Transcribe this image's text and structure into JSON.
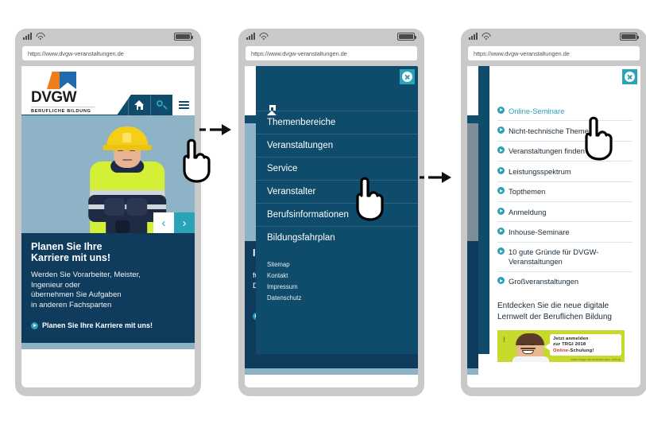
{
  "browser": {
    "url": "https://www.dvgw-veranstaltungen.de",
    "status_icons": {
      "signal": "signal-bars-icon",
      "wifi": "wifi-icon",
      "battery": "battery-icon"
    }
  },
  "brand": {
    "name": "DVGW",
    "tagline": "BERUFLICHE BILDUNG",
    "accent_blue": "#0f4c6b",
    "accent_teal": "#29a3b8",
    "accent_orange": "#ef7d1a",
    "deep_blue": "#0f3b5c"
  },
  "phone1": {
    "nav": {
      "home_icon": "home-icon",
      "search_icon": "search-icon",
      "menu_icon": "hamburger-menu-icon"
    },
    "hero": {
      "prev_label": "‹",
      "next_label": "›"
    },
    "teaser": {
      "heading_line1": "Planen Sie Ihre",
      "heading_line2": "Karriere mit uns!",
      "body_line1": "Werden Sie Vorarbeiter, Meister,",
      "body_line2": "Ingenieur oder",
      "body_line3": "übernehmen Sie Aufgaben",
      "body_line4": "in anderen Fachsparten",
      "link": "Planen Sie Ihre Karriere mit uns!"
    }
  },
  "phone2": {
    "close_icon": "close-icon",
    "home_icon": "home-icon",
    "menu_items": [
      {
        "label": "Themenbereiche"
      },
      {
        "label": "Veranstaltungen"
      },
      {
        "label": "Service"
      },
      {
        "label": "Veranstalter"
      },
      {
        "label": "Berufsinformationen"
      },
      {
        "label": "Bildungsfahrplan"
      }
    ],
    "footer_links": [
      {
        "label": "Sitemap"
      },
      {
        "label": "Kontakt"
      },
      {
        "label": "Impressum"
      },
      {
        "label": "Datenschutz"
      }
    ],
    "background_text": {
      "heading": "I",
      "line1": "fü",
      "line2": "D"
    }
  },
  "phone3": {
    "close_icon": "close-icon",
    "submenu_items": [
      {
        "label": "Online-Seminare",
        "active": true
      },
      {
        "label": "Nicht-technische Themen",
        "active": false
      },
      {
        "label": "Veranstaltungen finden",
        "active": false
      },
      {
        "label": "Leistungsspektrum",
        "active": false
      },
      {
        "label": "Topthemen",
        "active": false
      },
      {
        "label": "Anmeldung",
        "active": false
      },
      {
        "label": "Inhouse-Seminare",
        "active": false
      },
      {
        "label": "10 gute Gründe für DVGW-Veranstaltungen",
        "active": false
      },
      {
        "label": "Großveranstaltungen",
        "active": false
      }
    ],
    "promo": {
      "heading_line1": "Entdecken Sie die neue digitale",
      "heading_line2": "Lernwelt der Beruflichen Bildung",
      "banner": {
        "line1": "Jetzt anmelden",
        "line2": "zur TRGI 2018",
        "line3_red": "Online",
        "line3_rest": "-Schulung!",
        "url": "www.dvgw-veranstaltungen.de/trgi",
        "exclaim": "!"
      }
    }
  },
  "flow": {
    "arrow1": "dashed-arrow-right",
    "arrow2": "dashed-arrow-right",
    "cursor1": "pointing-hand-cursor",
    "cursor2": "pointing-hand-cursor",
    "cursor3": "pointing-hand-cursor"
  }
}
